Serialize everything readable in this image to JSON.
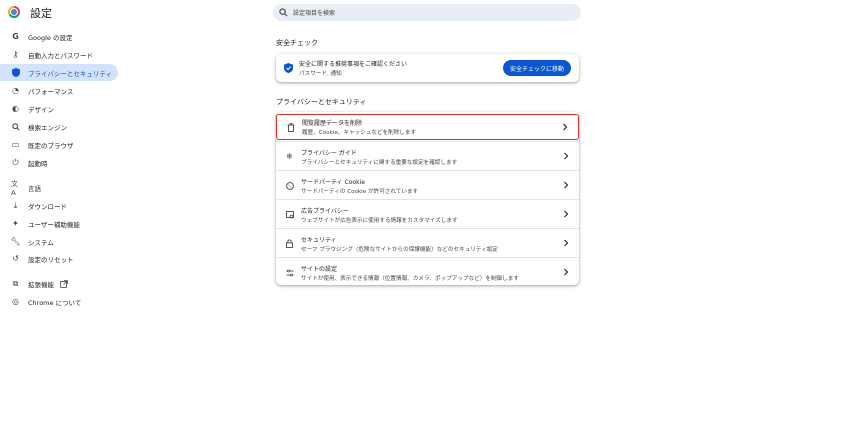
{
  "app": {
    "title": "設定"
  },
  "search": {
    "placeholder": "設定項目を検索"
  },
  "sidebar": {
    "items": [
      {
        "label": "Google の設定",
        "icon": "google-g-icon"
      },
      {
        "label": "自動入力とパスワード",
        "icon": "key-icon"
      },
      {
        "label": "プライバシーとセキュリティ",
        "icon": "shield-icon",
        "active": true
      },
      {
        "label": "パフォーマンス",
        "icon": "speedometer-icon"
      },
      {
        "label": "デザイン",
        "icon": "palette-icon"
      },
      {
        "label": "検索エンジン",
        "icon": "search-icon"
      },
      {
        "label": "既定のブラウザ",
        "icon": "browser-window-icon"
      },
      {
        "label": "起動時",
        "icon": "power-icon"
      },
      {
        "label": "言語",
        "icon": "translate-icon"
      },
      {
        "label": "ダウンロード",
        "icon": "download-icon"
      },
      {
        "label": "ユーザー補助機能",
        "icon": "accessibility-icon"
      },
      {
        "label": "システム",
        "icon": "wrench-icon"
      },
      {
        "label": "設定のリセット",
        "icon": "reset-icon"
      },
      {
        "label": "拡張機能",
        "icon": "puzzle-icon"
      },
      {
        "label": "Chrome について",
        "icon": "chrome-icon"
      }
    ]
  },
  "safety": {
    "section_title": "安全チェック",
    "title": "安全に関する推奨事項をご確認ください",
    "subtitle": "パスワード, 通知",
    "button_label": "安全チェックに移動"
  },
  "privacy": {
    "section_title": "プライバシーとセキュリティ",
    "rows": [
      {
        "title": "閲覧履歴データを削除",
        "subtitle": "履歴、Cookie、キャッシュなどを削除します",
        "icon": "trash-icon"
      },
      {
        "title": "プライバシー ガイド",
        "subtitle": "プライバシーとセキュリティに関する重要な設定を確認します",
        "icon": "guide-icon"
      },
      {
        "title": "サードパーティ Cookie",
        "subtitle": "サードパーティの Cookie が許可されています",
        "icon": "cookie-icon"
      },
      {
        "title": "広告プライバシー",
        "subtitle": "ウェブサイトが広告表示に使用する情報をカスタマイズします",
        "icon": "ad-privacy-icon"
      },
      {
        "title": "セキュリティ",
        "subtitle": "セーフ ブラウジング（危険なサイトからの保護機能）などのセキュリティ設定",
        "icon": "lock-icon"
      },
      {
        "title": "サイトの設定",
        "subtitle": "サイトが使用、表示できる情報（位置情報、カメラ、ポップアップなど）を制御します",
        "icon": "sliders-icon"
      }
    ]
  },
  "colors": {
    "accent": "#0b57d0",
    "active_bg": "#d3e3fd",
    "highlight": "#d93025"
  }
}
